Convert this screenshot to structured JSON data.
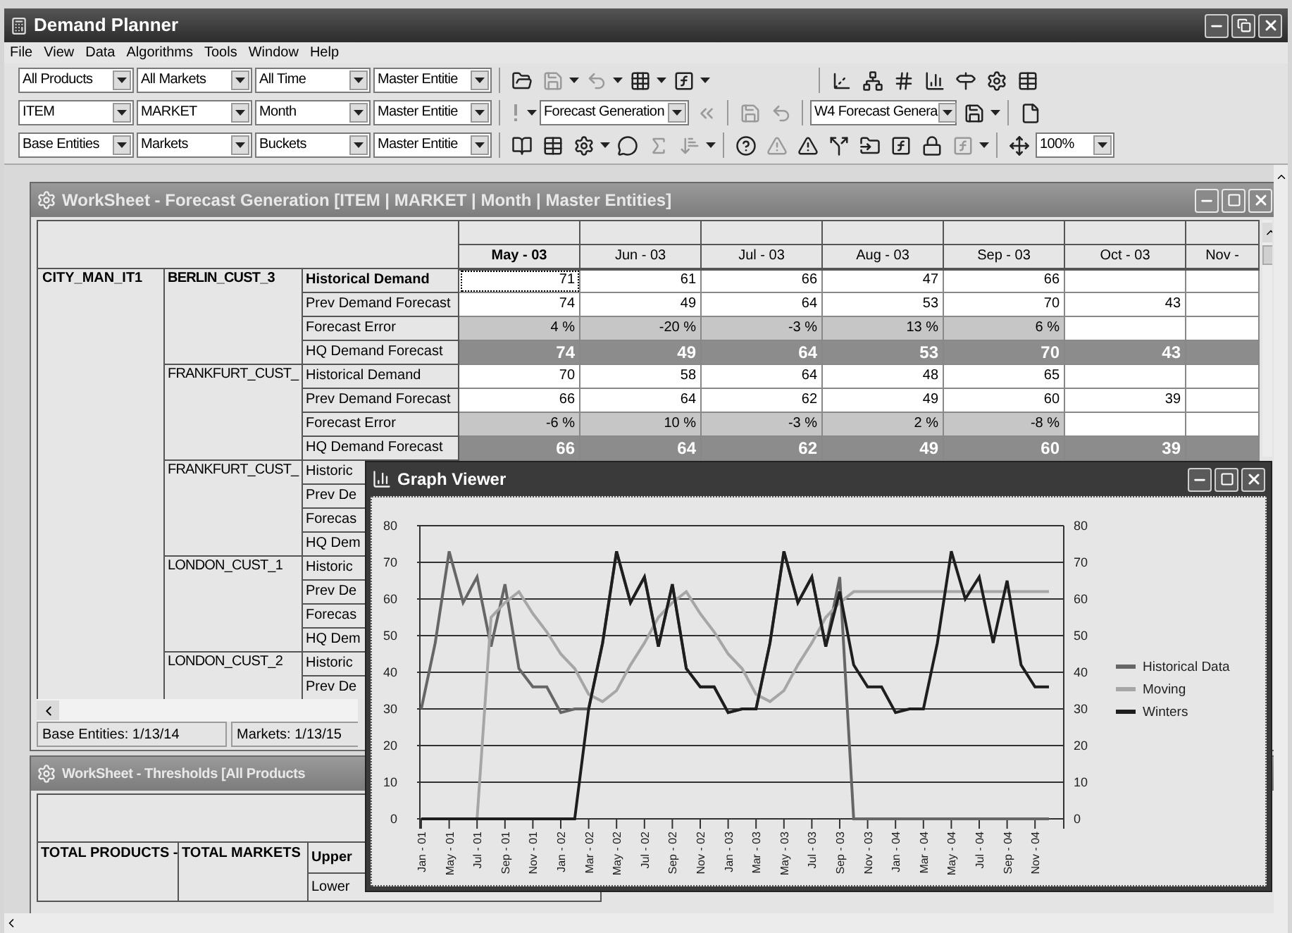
{
  "window": {
    "title": "Demand Planner"
  },
  "menu": [
    "File",
    "View",
    "Data",
    "Algorithms",
    "Tools",
    "Window",
    "Help"
  ],
  "toolbar_rows": [
    {
      "combos": [
        "All Products",
        "All Markets",
        "All Time",
        "Master Entitie"
      ]
    },
    {
      "combos": [
        "ITEM",
        "MARKET",
        "Month",
        "Master Entitie"
      ]
    },
    {
      "combos": [
        "Base Entities",
        "Markets",
        "Buckets",
        "Master Entitie"
      ]
    }
  ],
  "scenario_combo": "Forecast Generation",
  "view_combo": "W4 Forecast Genera",
  "zoom_combo": "100%",
  "worksheet": {
    "title": "WorkSheet - Forecast Generation [ITEM | MARKET | Month | Master Entities]",
    "columns": [
      "May - 03",
      "Jun - 03",
      "Jul - 03",
      "Aug - 03",
      "Sep - 03",
      "Oct - 03",
      "Nov -"
    ],
    "item": "CITY_MAN_IT1",
    "groups": [
      {
        "market": "BERLIN_CUST_3",
        "rows": [
          {
            "kind": "plain",
            "measure": "Historical Demand",
            "selected": true,
            "cells": [
              "71",
              "61",
              "66",
              "47",
              "66",
              null,
              null
            ]
          },
          {
            "kind": "plain",
            "measure": "Prev Demand Forecast",
            "selected": false,
            "cells": [
              "74",
              "49",
              "64",
              "53",
              "70",
              "43",
              null
            ]
          },
          {
            "kind": "error",
            "measure": "Forecast Error",
            "selected": false,
            "cells": [
              "4 %",
              "-20 %",
              "-3 %",
              "13 %",
              "6 %",
              null,
              null
            ]
          },
          {
            "kind": "hq",
            "measure": "HQ Demand Forecast",
            "selected": false,
            "cells": [
              "74",
              "49",
              "64",
              "53",
              "70",
              "43",
              null
            ]
          }
        ]
      },
      {
        "market": "FRANKFURT_CUST_",
        "rows": [
          {
            "kind": "plain",
            "measure": "Historical Demand",
            "selected": false,
            "cells": [
              "70",
              "58",
              "64",
              "48",
              "65",
              null,
              null
            ]
          },
          {
            "kind": "plain",
            "measure": "Prev Demand Forecast",
            "selected": false,
            "cells": [
              "66",
              "64",
              "62",
              "49",
              "60",
              "39",
              null
            ]
          },
          {
            "kind": "error",
            "measure": "Forecast Error",
            "selected": false,
            "cells": [
              "-6 %",
              "10 %",
              "-3 %",
              "2 %",
              "-8 %",
              null,
              null
            ]
          },
          {
            "kind": "hq",
            "measure": "HQ Demand Forecast",
            "selected": false,
            "cells": [
              "66",
              "64",
              "62",
              "49",
              "60",
              "39",
              null
            ]
          }
        ]
      },
      {
        "market": "FRANKFURT_CUST_",
        "rows": [
          {
            "measure": "Historic",
            "selected": false
          },
          {
            "measure": "Prev De",
            "selected": false
          },
          {
            "measure": "Forecas",
            "selected": false
          },
          {
            "measure": "HQ Dem",
            "selected": false
          }
        ]
      },
      {
        "market": "LONDON_CUST_1",
        "rows": [
          {
            "measure": "Historic",
            "selected": false
          },
          {
            "measure": "Prev De",
            "selected": false
          },
          {
            "measure": "Forecas",
            "selected": false
          },
          {
            "measure": "HQ Dem",
            "selected": false
          }
        ]
      },
      {
        "market": "LONDON_CUST_2",
        "rows": [
          {
            "measure": "Historic",
            "selected": false
          },
          {
            "measure": "Prev De",
            "selected": false
          }
        ]
      }
    ],
    "status": [
      "Base Entities: 1/13/14",
      "Markets: 1/13/15"
    ]
  },
  "thresholds": {
    "title": "WorkSheet - Thresholds [All Products",
    "products": "TOTAL PRODUCTS -",
    "markets": "TOTAL MARKETS",
    "measures": [
      "Upper",
      "Lower"
    ]
  },
  "graph": {
    "title": "Graph Viewer",
    "right_axis_labels": [
      "80",
      "70",
      "60",
      "50",
      "40",
      "30",
      "20",
      "10",
      "0"
    ],
    "chart_data": {
      "type": "line",
      "categories": [
        "Jan - 01",
        null,
        "May - 01",
        null,
        "Jul - 01",
        null,
        "Sep - 01",
        null,
        "Nov - 01",
        null,
        "Jan - 02",
        null,
        "Mar - 02",
        null,
        "May - 02",
        null,
        "Jul - 02",
        null,
        "Sep - 02",
        null,
        "Nov - 02",
        null,
        "Jan - 03",
        null,
        "Mar - 03",
        null,
        "May - 03",
        null,
        "Jul - 03",
        null,
        "Sep - 03",
        null,
        "Nov - 03",
        null,
        "Jan - 04",
        null,
        "Mar - 04",
        null,
        "May - 04",
        null,
        "Jul - 04",
        null,
        "Sep - 04",
        null,
        "Nov - 04",
        null
      ],
      "ylim": [
        0,
        80
      ],
      "yticks": [
        0,
        10,
        20,
        30,
        40,
        50,
        60,
        70,
        80
      ],
      "grid": true,
      "legend": "right",
      "series": [
        {
          "name": "Historical Data",
          "color": "#666666",
          "values": [
            30,
            48,
            73,
            59,
            66,
            47,
            64,
            41,
            36,
            36,
            29,
            30,
            30,
            48,
            73,
            59,
            66,
            47,
            64,
            41,
            36,
            36,
            29,
            30,
            30,
            48,
            73,
            59,
            66,
            47,
            66,
            0,
            0,
            0,
            0,
            0,
            0,
            0,
            0,
            0,
            0,
            0,
            0,
            0,
            0,
            0
          ]
        },
        {
          "name": "Moving",
          "color": "#a6a6a6",
          "values": [
            0,
            0,
            0,
            0,
            0,
            55,
            59,
            62,
            56,
            51,
            45,
            41,
            34,
            32,
            35,
            42,
            48,
            55,
            59,
            62,
            56,
            51,
            45,
            41,
            34,
            32,
            35,
            42,
            48,
            55,
            59,
            62,
            62,
            62,
            62,
            62,
            62,
            62,
            62,
            62,
            62,
            62,
            62,
            62,
            62,
            62
          ]
        },
        {
          "name": "Winters",
          "color": "#1e1e1e",
          "values": [
            0,
            0,
            0,
            0,
            0,
            0,
            0,
            0,
            0,
            0,
            0,
            0,
            30,
            48,
            73,
            59,
            66,
            47,
            64,
            41,
            36,
            36,
            29,
            30,
            30,
            48,
            73,
            59,
            66,
            47,
            62,
            42,
            36,
            36,
            29,
            30,
            30,
            48,
            73,
            60,
            66,
            48,
            65,
            42,
            36,
            36
          ]
        }
      ]
    }
  }
}
